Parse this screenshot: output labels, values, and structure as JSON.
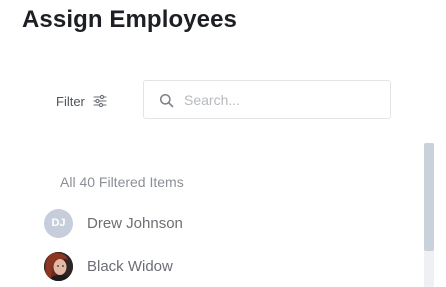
{
  "page": {
    "title": "Assign Employees"
  },
  "toolbar": {
    "filter_label": "Filter",
    "search_placeholder": "Search..."
  },
  "list": {
    "count_label": "All 40 Filtered Items",
    "employees": [
      {
        "name": "Drew Johnson",
        "initials": "DJ",
        "avatar_type": "initials"
      },
      {
        "name": "Black Widow",
        "initials": "",
        "avatar_type": "photo"
      }
    ]
  },
  "colors": {
    "title": "#1d1f24",
    "muted_text": "#8b8f96",
    "name_text": "#6b6e74",
    "initials_avatar_bg": "#c5ceda",
    "input_border": "#e2e4e8",
    "scroll_thumb": "#c9d1da"
  },
  "icons": {
    "filter": "sliders-icon",
    "search": "search-icon"
  }
}
